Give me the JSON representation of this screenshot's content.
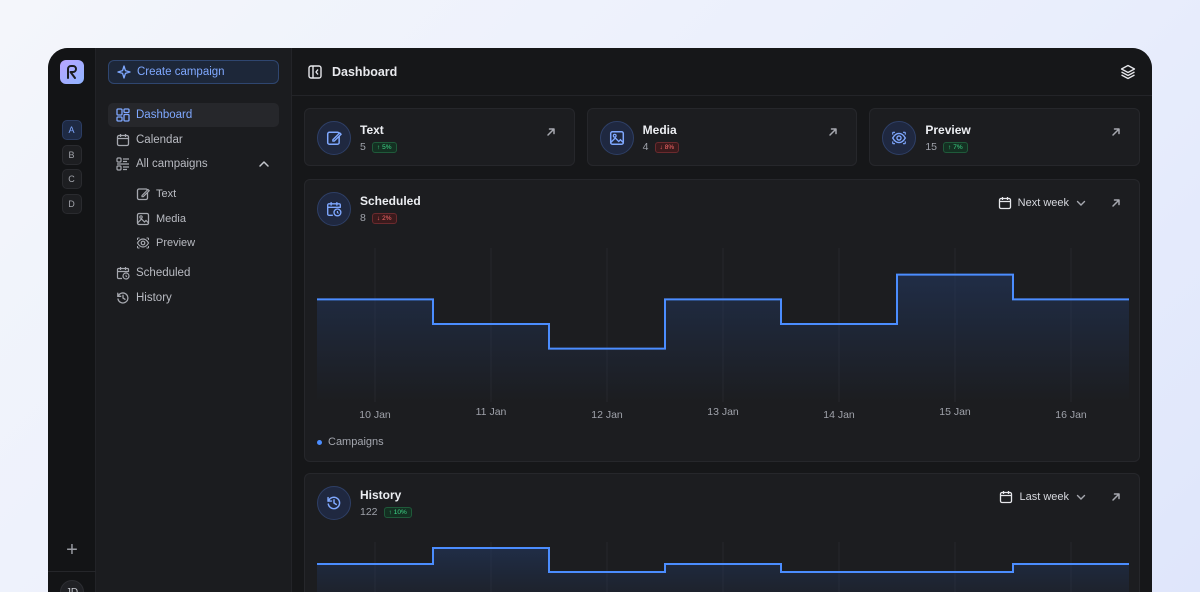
{
  "sidebar": {
    "create_label": "Create campaign",
    "items": [
      {
        "label": "Dashboard",
        "icon": "dashboard-icon",
        "active": true
      },
      {
        "label": "Calendar",
        "icon": "calendar-icon"
      },
      {
        "label": "All campaigns",
        "icon": "list-icon",
        "expanded": true
      }
    ],
    "subitems": [
      {
        "label": "Text",
        "icon": "edit-icon"
      },
      {
        "label": "Media",
        "icon": "image-icon"
      },
      {
        "label": "Preview",
        "icon": "eye-icon"
      }
    ],
    "items_after": [
      {
        "label": "Scheduled",
        "icon": "calendar-clock-icon"
      },
      {
        "label": "History",
        "icon": "history-icon"
      }
    ]
  },
  "rail": {
    "workspaces": [
      "A",
      "B",
      "C",
      "D"
    ],
    "active_workspace": "A",
    "add_label": "+",
    "avatar": "JD"
  },
  "header": {
    "title": "Dashboard"
  },
  "cards": [
    {
      "title": "Text",
      "count": "5",
      "change": "5%",
      "direction": "up",
      "icon": "edit-icon"
    },
    {
      "title": "Media",
      "count": "4",
      "change": "8%",
      "direction": "down",
      "icon": "image-icon"
    },
    {
      "title": "Preview",
      "count": "15",
      "change": "7%",
      "direction": "up",
      "icon": "eye-icon"
    }
  ],
  "scheduled": {
    "title": "Scheduled",
    "count": "8",
    "change": "2%",
    "direction": "down",
    "range": "Next week",
    "legend": "Campaigns"
  },
  "history": {
    "title": "History",
    "count": "122",
    "change": "10%",
    "direction": "up",
    "range": "Last week"
  },
  "colors": {
    "accent": "#4b8dff",
    "up": "#3fd98a",
    "down": "#ff6b6b"
  },
  "chart_data": [
    {
      "type": "line",
      "step": true,
      "categories": [
        "10 Jan",
        "11 Jan",
        "12 Jan",
        "13 Jan",
        "14 Jan",
        "15 Jan",
        "16 Jan"
      ],
      "series": [
        {
          "name": "Campaigns",
          "values": [
            4,
            3,
            2,
            4,
            3,
            5,
            4
          ]
        }
      ],
      "ylim": [
        0,
        6
      ],
      "grid": true,
      "legend": "bottom-left"
    },
    {
      "type": "line",
      "step": true,
      "categories": [
        "",
        "",
        "",
        "",
        "",
        "",
        ""
      ],
      "series": [
        {
          "values": [
            4,
            6,
            3,
            4,
            3,
            3,
            4
          ]
        }
      ],
      "ylim": [
        0,
        6.5
      ],
      "grid": true
    }
  ]
}
